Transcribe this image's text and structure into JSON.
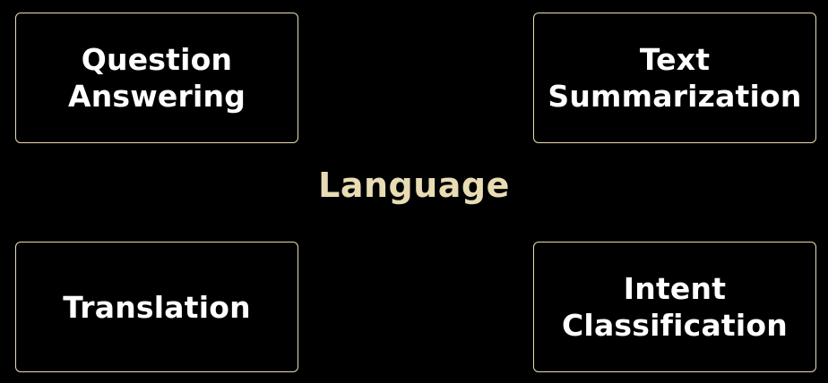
{
  "diagram": {
    "center_label": "Language",
    "nodes": [
      {
        "id": "tl",
        "label": "Question\nAnswering"
      },
      {
        "id": "tr",
        "label": "Text\nSummarization"
      },
      {
        "id": "bl",
        "label": "Translation"
      },
      {
        "id": "br",
        "label": "Intent\nClassification"
      }
    ]
  },
  "colors": {
    "background": "#000000",
    "accent": "#e8dcb4",
    "text": "#ffffff"
  }
}
